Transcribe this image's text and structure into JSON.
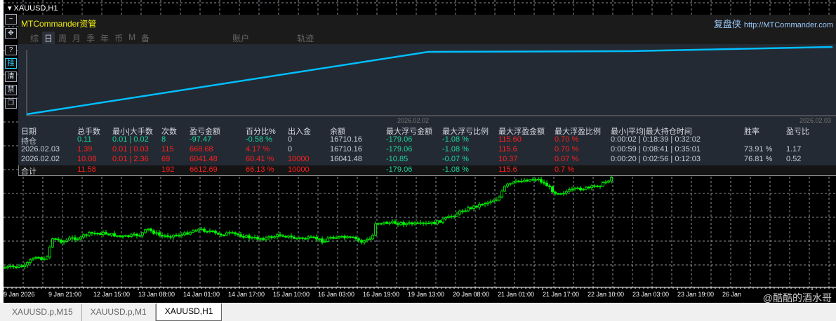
{
  "window": {
    "title": "XAUUSD,H1"
  },
  "toolbar": [
    {
      "icon": "minus-icon",
      "glyph": "−"
    },
    {
      "icon": "move-icon",
      "glyph": "✥"
    },
    {
      "icon": "help-icon",
      "glyph": "?"
    },
    {
      "icon": "pending-icon",
      "glyph": "挂"
    },
    {
      "icon": "clear-icon",
      "glyph": "清"
    },
    {
      "icon": "forbid-icon",
      "glyph": "禁"
    },
    {
      "icon": "restore-icon",
      "glyph": "❐"
    }
  ],
  "panel": {
    "title": "MTCommander资管",
    "brand": "复盘侠",
    "url": "http://MTCommander.com",
    "tabs": [
      "综",
      "日",
      "周",
      "月",
      "季",
      "年",
      "币",
      "M",
      "备",
      "账户",
      "轨迹"
    ],
    "active_tab": "日",
    "equity": {
      "dates": [
        "2026.02.02",
        "2026.02.03"
      ]
    },
    "headers": [
      "日期",
      "总手数",
      "最小|大手数",
      "次数",
      "盈亏金额",
      "百分比%",
      "出入金",
      "余额",
      "最大浮亏金额",
      "最大浮亏比例",
      "最大浮盈金额",
      "最大浮盈比例",
      "最小|平均|最大持仓时间",
      "胜率",
      "盈亏比"
    ],
    "rows": [
      [
        "持仓",
        "0.11",
        "0.01 | 0.02",
        "8",
        "-97.47",
        "-0.58 %",
        "0",
        "16710.16",
        "-179.06",
        "-1.08 %",
        "115.60",
        "0.70 %",
        "0:00:02 | 0:18:39 | 0:32:02",
        "",
        ""
      ],
      [
        "2026.02.03",
        "1.39",
        "0.01 | 0.03",
        "115",
        "668.68",
        "4.17 %",
        "0",
        "16710.16",
        "-179.06",
        "-1.08 %",
        "115.6",
        "0.70 %",
        "0:00:59 | 0:08:41 | 0:35:01",
        "73.91 %",
        "1.17"
      ],
      [
        "2026.02.02",
        "10.08",
        "0.01 | 2.36",
        "69",
        "6041.48",
        "60.41 %",
        "10000",
        "16041.48",
        "-10.85",
        "-0.07 %",
        "10.37",
        "0.07 %",
        "0:00:20 | 0:02:56 | 0:12:03",
        "76.81 %",
        "0.52"
      ]
    ],
    "total": [
      "合计",
      "11.58",
      "",
      "192",
      "6612.69",
      "66.13 %",
      "10000",
      "",
      "-179.06",
      "-1.08 %",
      "115.6",
      "0.7 %",
      "",
      "",
      ""
    ]
  },
  "axis": [
    "9 Jan 2026",
    "9 Jan 21:00",
    "12 Jan 15:00",
    "13 Jan 08:00",
    "14 Jan 01:00",
    "14 Jan 17:00",
    "15 Jan 10:00",
    "16 Jan 03:00",
    "16 Jan 19:00",
    "19 Jan 13:00",
    "20 Jan 08:00",
    "21 Jan 01:00",
    "21 Jan 17:00",
    "22 Jan 10:00",
    "23 Jan 03:00",
    "23 Jan 19:00",
    "26 Jan"
  ],
  "bottom_tabs": [
    "XAUUSD.p,M15",
    "XAUUSD.p,M1",
    "XAUUSD,H1"
  ],
  "watermark": "@酷酷的酒水哥",
  "colors": {
    "equity": "#00bfff",
    "candle": "#00ff00",
    "profit": "#ff1f1f",
    "loss": "#19d6a0"
  }
}
